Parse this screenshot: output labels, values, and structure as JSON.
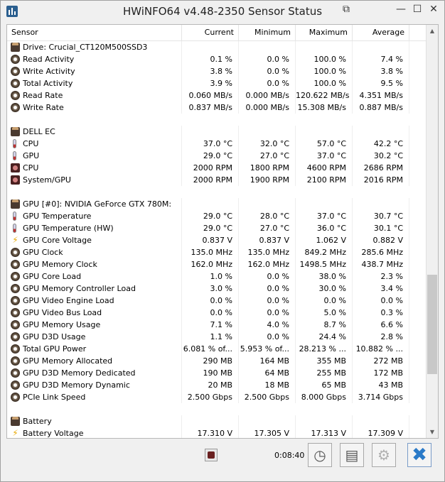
{
  "window": {
    "title": "HWiNFO64 v4.48-2350 Sensor Status",
    "controls": {
      "restore": "⧉",
      "minimize": "—",
      "maximize": "☐",
      "close": "✕"
    }
  },
  "columns": {
    "sensor": "Sensor",
    "current": "Current",
    "minimum": "Minimum",
    "maximum": "Maximum",
    "average": "Average"
  },
  "rows": [
    {
      "type": "group",
      "icon": "chip-icon",
      "name": "Drive: Crucial_CT120M500SSD3"
    },
    {
      "type": "data",
      "icon": "disk-icon",
      "name": "Read Activity",
      "current": "0.1 %",
      "minimum": "0.0 %",
      "maximum": "100.0 %",
      "average": "7.4 %"
    },
    {
      "type": "data",
      "icon": "disk-icon",
      "name": "Write Activity",
      "current": "3.8 %",
      "minimum": "0.0 %",
      "maximum": "100.0 %",
      "average": "3.8 %"
    },
    {
      "type": "data",
      "icon": "disk-icon",
      "name": "Total Activity",
      "current": "3.9 %",
      "minimum": "0.0 %",
      "maximum": "100.0 %",
      "average": "9.5 %"
    },
    {
      "type": "data",
      "icon": "disk-icon",
      "name": "Read Rate",
      "current": "0.060 MB/s",
      "minimum": "0.000 MB/s",
      "maximum": "120.622 MB/s",
      "average": "4.351 MB/s"
    },
    {
      "type": "data",
      "icon": "disk-icon",
      "name": "Write Rate",
      "current": "0.837 MB/s",
      "minimum": "0.000 MB/s",
      "maximum": "15.308 MB/s",
      "average": "0.887 MB/s"
    },
    {
      "type": "spacer"
    },
    {
      "type": "group",
      "icon": "chip-icon",
      "name": "DELL EC"
    },
    {
      "type": "data",
      "icon": "thermometer-icon",
      "name": "CPU",
      "current": "37.0 °C",
      "minimum": "32.0 °C",
      "maximum": "57.0 °C",
      "average": "42.2 °C"
    },
    {
      "type": "data",
      "icon": "thermometer-icon",
      "name": "GPU",
      "current": "29.0 °C",
      "minimum": "27.0 °C",
      "maximum": "37.0 °C",
      "average": "30.2 °C"
    },
    {
      "type": "data",
      "icon": "fan-icon",
      "name": "CPU",
      "current": "2000 RPM",
      "minimum": "1800 RPM",
      "maximum": "4600 RPM",
      "average": "2686 RPM"
    },
    {
      "type": "data",
      "icon": "fan-icon",
      "name": "System/GPU",
      "current": "2000 RPM",
      "minimum": "1900 RPM",
      "maximum": "2100 RPM",
      "average": "2016 RPM"
    },
    {
      "type": "spacer"
    },
    {
      "type": "group",
      "icon": "chip-icon",
      "name": "GPU [#0]: NVIDIA GeForce GTX 780M:"
    },
    {
      "type": "data",
      "icon": "thermometer-icon",
      "name": "GPU Temperature",
      "current": "29.0 °C",
      "minimum": "28.0 °C",
      "maximum": "37.0 °C",
      "average": "30.7 °C"
    },
    {
      "type": "data",
      "icon": "thermometer-icon",
      "name": "GPU Temperature (HW)",
      "current": "29.0 °C",
      "minimum": "27.0 °C",
      "maximum": "36.0 °C",
      "average": "30.1 °C"
    },
    {
      "type": "data",
      "icon": "bolt-icon",
      "name": "GPU Core Voltage",
      "current": "0.837 V",
      "minimum": "0.837 V",
      "maximum": "1.062 V",
      "average": "0.882 V"
    },
    {
      "type": "data",
      "icon": "disk-icon",
      "name": "GPU Clock",
      "current": "135.0 MHz",
      "minimum": "135.0 MHz",
      "maximum": "849.2 MHz",
      "average": "285.6 MHz"
    },
    {
      "type": "data",
      "icon": "disk-icon",
      "name": "GPU Memory Clock",
      "current": "162.0 MHz",
      "minimum": "162.0 MHz",
      "maximum": "1498.5 MHz",
      "average": "438.7 MHz"
    },
    {
      "type": "data",
      "icon": "disk-icon",
      "name": "GPU Core Load",
      "current": "1.0 %",
      "minimum": "0.0 %",
      "maximum": "38.0 %",
      "average": "2.3 %"
    },
    {
      "type": "data",
      "icon": "disk-icon",
      "name": "GPU Memory Controller Load",
      "current": "3.0 %",
      "minimum": "0.0 %",
      "maximum": "30.0 %",
      "average": "3.4 %"
    },
    {
      "type": "data",
      "icon": "disk-icon",
      "name": "GPU Video Engine Load",
      "current": "0.0 %",
      "minimum": "0.0 %",
      "maximum": "0.0 %",
      "average": "0.0 %"
    },
    {
      "type": "data",
      "icon": "disk-icon",
      "name": "GPU Video Bus Load",
      "current": "0.0 %",
      "minimum": "0.0 %",
      "maximum": "5.0 %",
      "average": "0.3 %"
    },
    {
      "type": "data",
      "icon": "disk-icon",
      "name": "GPU Memory Usage",
      "current": "7.1 %",
      "minimum": "4.0 %",
      "maximum": "8.7 %",
      "average": "6.6 %"
    },
    {
      "type": "data",
      "icon": "disk-icon",
      "name": "GPU D3D Usage",
      "current": "1.1 %",
      "minimum": "0.0 %",
      "maximum": "24.4 %",
      "average": "2.8 %"
    },
    {
      "type": "data",
      "icon": "disk-icon",
      "name": "Total GPU Power",
      "current": "6.081 % of...",
      "minimum": "5.953 % of...",
      "maximum": "28.213 % ...",
      "average": "10.882 % ..."
    },
    {
      "type": "data",
      "icon": "disk-icon",
      "name": "GPU Memory Allocated",
      "current": "290 MB",
      "minimum": "164 MB",
      "maximum": "355 MB",
      "average": "272 MB"
    },
    {
      "type": "data",
      "icon": "disk-icon",
      "name": "GPU D3D Memory Dedicated",
      "current": "190 MB",
      "minimum": "64 MB",
      "maximum": "255 MB",
      "average": "172 MB"
    },
    {
      "type": "data",
      "icon": "disk-icon",
      "name": "GPU D3D Memory Dynamic",
      "current": "20 MB",
      "minimum": "18 MB",
      "maximum": "65 MB",
      "average": "43 MB"
    },
    {
      "type": "data",
      "icon": "disk-icon",
      "name": "PCIe Link Speed",
      "current": "2.500 Gbps",
      "minimum": "2.500 Gbps",
      "maximum": "8.000 Gbps",
      "average": "3.714 Gbps"
    },
    {
      "type": "spacer"
    },
    {
      "type": "group",
      "icon": "chip-icon",
      "name": "Battery"
    },
    {
      "type": "data",
      "icon": "bolt-icon",
      "name": "Battery Voltage",
      "current": "17.310 V",
      "minimum": "17.305 V",
      "maximum": "17.313 V",
      "average": "17.309 V"
    }
  ],
  "scrollbar": {
    "up": "▲",
    "down": "▼",
    "position": 0.82
  },
  "footer": {
    "elapsed_time": "0:08:40",
    "clock_glyph": "◷",
    "report_glyph": "▤",
    "settings_glyph": "⚙",
    "close_glyph": "✖"
  },
  "colors": {
    "close_accent": "#2a7ac8",
    "bolt": "#e8a800"
  }
}
